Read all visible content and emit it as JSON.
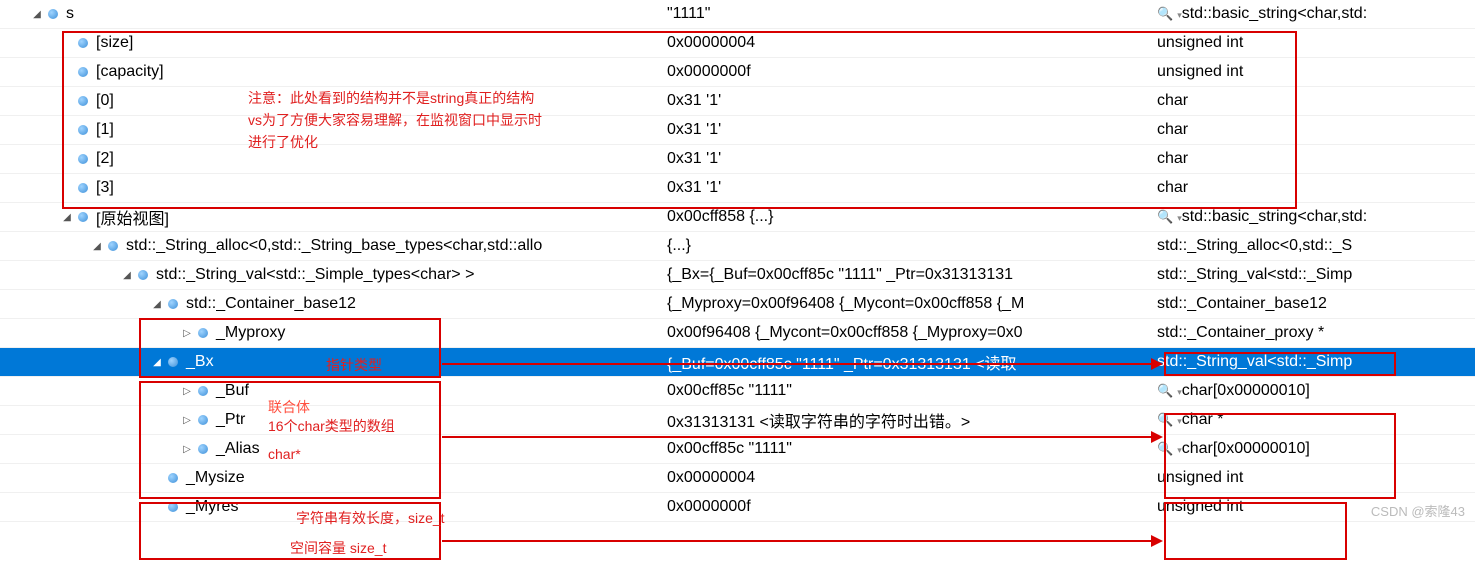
{
  "rows": [
    {
      "indent": 0,
      "exp": "◢",
      "name": "s",
      "value": "\"1111\"",
      "type": "std::basic_string<char,std:",
      "mag": true,
      "dd": true
    },
    {
      "indent": 30,
      "exp": "",
      "name": "[size]",
      "value": "0x00000004",
      "type": "unsigned int"
    },
    {
      "indent": 30,
      "exp": "",
      "name": "[capacity]",
      "value": "0x0000000f",
      "type": "unsigned int"
    },
    {
      "indent": 30,
      "exp": "",
      "name": "[0]",
      "value": "0x31 '1'",
      "type": "char"
    },
    {
      "indent": 30,
      "exp": "",
      "name": "[1]",
      "value": "0x31 '1'",
      "type": "char"
    },
    {
      "indent": 30,
      "exp": "",
      "name": "[2]",
      "value": "0x31 '1'",
      "type": "char"
    },
    {
      "indent": 30,
      "exp": "",
      "name": "[3]",
      "value": "0x31 '1'",
      "type": "char"
    },
    {
      "indent": 30,
      "exp": "◢",
      "name": "[原始视图]",
      "value": "0x00cff858 {...}",
      "type": "std::basic_string<char,std:",
      "mag": true,
      "dd": true
    },
    {
      "indent": 60,
      "exp": "◢",
      "name": "std::_String_alloc<0,std::_String_base_types<char,std::allo",
      "value": "{...}",
      "type": "std::_String_alloc<0,std::_S"
    },
    {
      "indent": 90,
      "exp": "◢",
      "name": "std::_String_val<std::_Simple_types<char> >",
      "value": "{_Bx={_Buf=0x00cff85c \"1111\" _Ptr=0x31313131",
      "type": "std::_String_val<std::_Simp"
    },
    {
      "indent": 120,
      "exp": "◢",
      "name": "std::_Container_base12",
      "value": "{_Myproxy=0x00f96408 {_Mycont=0x00cff858 {_M",
      "type": "std::_Container_base12"
    },
    {
      "indent": 150,
      "exp": "▷",
      "name": "_Myproxy",
      "value": "0x00f96408 {_Mycont=0x00cff858 {_Myproxy=0x0",
      "type": "std::_Container_proxy *"
    },
    {
      "indent": 120,
      "exp": "◢",
      "name": "_Bx",
      "value": "{_Buf=0x00cff85c \"1111\" _Ptr=0x31313131 <读取",
      "type": "std::_String_val<std::_Simp",
      "selected": true
    },
    {
      "indent": 150,
      "exp": "▷",
      "name": "_Buf",
      "value": "0x00cff85c \"1111\"",
      "type": "char[0x00000010]",
      "mag": true,
      "dd": true
    },
    {
      "indent": 150,
      "exp": "▷",
      "name": "_Ptr",
      "value": "0x31313131 <读取字符串的字符时出错。>",
      "type": "char *",
      "mag": true,
      "dd": true
    },
    {
      "indent": 150,
      "exp": "▷",
      "name": "_Alias",
      "value": "0x00cff85c \"1111\"",
      "type": "char[0x00000010]",
      "mag": true,
      "dd": true
    },
    {
      "indent": 120,
      "exp": "",
      "name": "_Mysize",
      "value": "0x00000004",
      "type": "unsigned int"
    },
    {
      "indent": 120,
      "exp": "",
      "name": "_Myres",
      "value": "0x0000000f",
      "type": "unsigned int"
    }
  ],
  "annotations": {
    "note1": "注意：此处看到的结构并不是string真正的结构",
    "note2": "vs为了方便大家容易理解，在监视窗口中显示时",
    "note3": "进行了优化",
    "a_myproxy": "指针类型",
    "a_bx": "联合体",
    "a_buf": "16个char类型的数组",
    "a_ptr": "char*",
    "a_mysize": "字符串有效长度，size_t",
    "a_myres": "空间容量  size_t"
  },
  "watermark": "CSDN @索隆43"
}
